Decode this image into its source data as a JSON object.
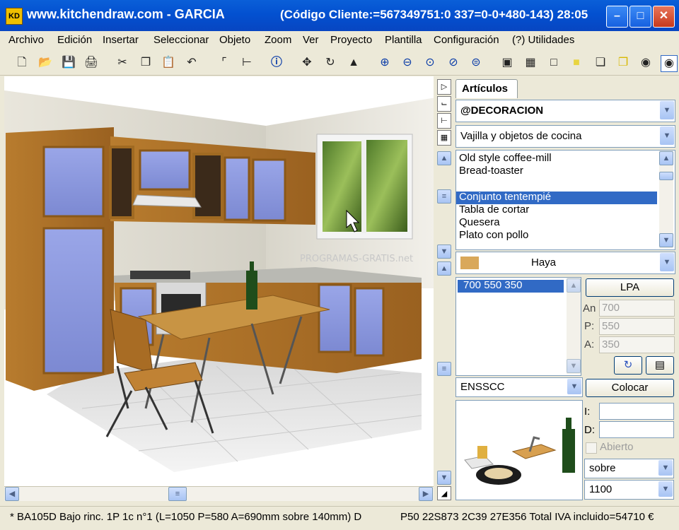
{
  "window": {
    "icon": "KD",
    "title": "www.kitchendraw.com - GARCIA",
    "client_info": "(Código Cliente:=567349751:0 337=0-0+480-143) 28:05"
  },
  "menu": [
    "Archivo",
    "Edición",
    "Insertar",
    "Seleccionar",
    "Objeto",
    "Zoom",
    "Ver",
    "Proyecto",
    "Plantilla",
    "Configuración",
    "(?) Utilidades"
  ],
  "toolbar_icons": [
    "new-document",
    "open-folder",
    "save",
    "print",
    "cut",
    "copy",
    "paste",
    "undo",
    "place-dimension",
    "measure",
    "info",
    "move",
    "rotate",
    "mirror",
    "zoom-in",
    "zoom-out",
    "zoom-window",
    "zoom-fit",
    "zoom-previous",
    "render",
    "scene",
    "wireframe",
    "color-fill",
    "box-3d",
    "solid-3d",
    "camera-photo",
    "camera"
  ],
  "watermark": "PROGRAMAS-GRATIS.net",
  "articles": {
    "tab_label": "Artículos",
    "catalog": "@DECORACION",
    "family": "Vajilla y objetos de cocina",
    "items": [
      "Old style coffee-mill",
      "Bread-toaster",
      "",
      "Conjunto tentempié",
      "Tabla de cortar",
      "Quesera",
      "Plato con pollo"
    ],
    "selected_index": 3,
    "finish_label": "Haya",
    "finish_color": "#d9a85a",
    "sizes": [
      "700  550  350"
    ],
    "lpa_button": "LPA",
    "an_label": "An",
    "an_value": "700",
    "p_label": "P:",
    "p_value": "550",
    "a_label": "A:",
    "a_value": "350",
    "code": "ENSSCC",
    "place_button": "Colocar",
    "i_label": "I:",
    "d_label": "D:",
    "open_label": "Abierto",
    "position": "sobre",
    "height": "1100"
  },
  "status": {
    "left": "* BA105D  Bajo rinc. 1P 1c n°1  (L=1050 P=580 A=690mm sobre 140mm) D",
    "right": "P50 22S873 2C39 27E356 Total IVA incluido=54710 €"
  }
}
